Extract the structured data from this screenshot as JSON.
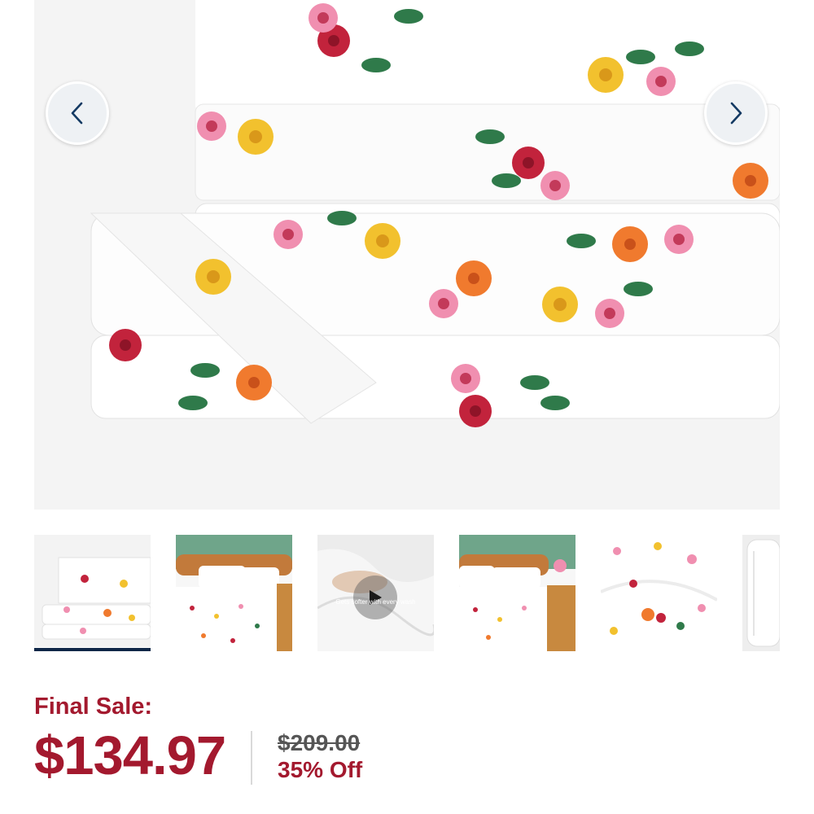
{
  "gallery": {
    "main_image_alt": "floral sheet set",
    "prev_icon": "chevron-left-icon",
    "next_icon": "chevron-right-icon",
    "thumbnails": [
      {
        "kind": "folded-sheets",
        "active": true
      },
      {
        "kind": "bedroom-bed",
        "active": false
      },
      {
        "kind": "video",
        "active": false,
        "caption": "Gets softer with every wash"
      },
      {
        "kind": "bedroom-bed-2",
        "active": false
      },
      {
        "kind": "sheet-closeup",
        "active": false
      },
      {
        "kind": "fitted-sheet",
        "active": false
      }
    ]
  },
  "pricing": {
    "sale_label": "Final Sale:",
    "price": "$134.97",
    "original_price": "$209.00",
    "discount": "35% Off"
  },
  "colors": {
    "sale_red": "#a3192e",
    "active_indicator": "#0f2748"
  }
}
